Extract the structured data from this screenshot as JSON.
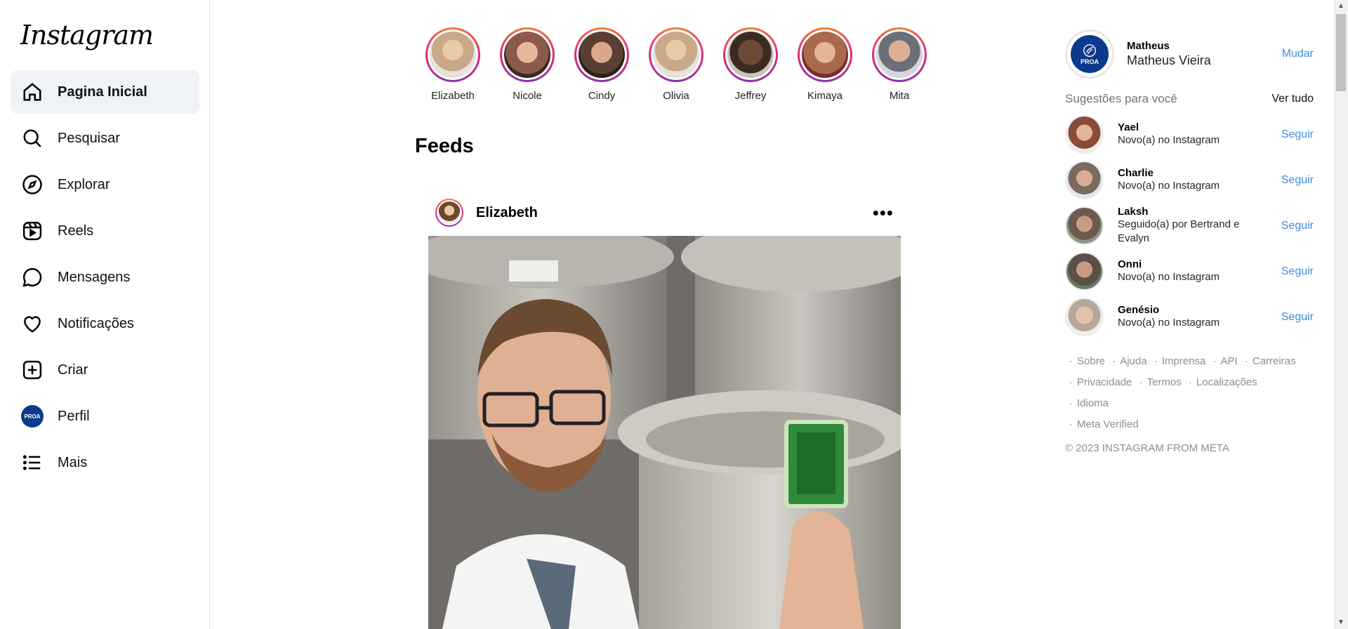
{
  "app": {
    "logo_text": "Instagram"
  },
  "nav": {
    "items": [
      {
        "label": "Pagina Inicial",
        "icon": "home-icon"
      },
      {
        "label": "Pesquisar",
        "icon": "search-icon"
      },
      {
        "label": "Explorar",
        "icon": "compass-icon"
      },
      {
        "label": "Reels",
        "icon": "reels-icon"
      },
      {
        "label": "Mensagens",
        "icon": "message-icon"
      },
      {
        "label": "Notificações",
        "icon": "heart-icon"
      },
      {
        "label": "Criar",
        "icon": "plus-square-icon"
      },
      {
        "label": "Perfil",
        "icon": "profile-avatar"
      },
      {
        "label": "Mais",
        "icon": "menu-icon"
      }
    ],
    "avatar_text": "PROA"
  },
  "stories": [
    {
      "name": "Elizabeth",
      "color": "#c9a98a"
    },
    {
      "name": "Nicole",
      "color": "#8b5a4a"
    },
    {
      "name": "Cindy",
      "color": "#5a3e34"
    },
    {
      "name": "Olivia",
      "color": "#c9a98a"
    },
    {
      "name": "Jeffrey",
      "color": "#3d2a22"
    },
    {
      "name": "Kimaya",
      "color": "#a86a4a"
    },
    {
      "name": "Mita",
      "color": "#6a6f78"
    }
  ],
  "feed": {
    "title": "Feeds",
    "post": {
      "user": "Elizabeth",
      "more_icon": "•••"
    }
  },
  "account": {
    "username": "Matheus",
    "full_name": "Matheus Vieira",
    "switch_label": "Mudar",
    "avatar_text": "PROA"
  },
  "suggestions": {
    "title": "Sugestões para você",
    "see_all": "Ver tudo",
    "follow_label": "Seguir",
    "items": [
      {
        "user": "Yael",
        "sub": "Novo(a) no Instagram",
        "color": "#8a4a3a"
      },
      {
        "user": "Charlie",
        "sub": "Novo(a) no Instagram",
        "color": "#7b6a5e"
      },
      {
        "user": "Laksh",
        "sub": "Seguido(a) por Bertrand e Evalyn",
        "color": "#6c5a4e"
      },
      {
        "user": "Onni",
        "sub": "Novo(a) no Instagram",
        "color": "#5d5048"
      },
      {
        "user": "Genésio",
        "sub": "Novo(a) no Instagram",
        "color": "#b7a79a"
      }
    ]
  },
  "footer": {
    "links": [
      "Sobre",
      "Ajuda",
      "Imprensa",
      "API",
      "Carreiras",
      "Privacidade",
      "Termos",
      "Localizações",
      "Idioma",
      "Meta Verified"
    ],
    "copyright": "© 2023 INSTAGRAM FROM META"
  }
}
